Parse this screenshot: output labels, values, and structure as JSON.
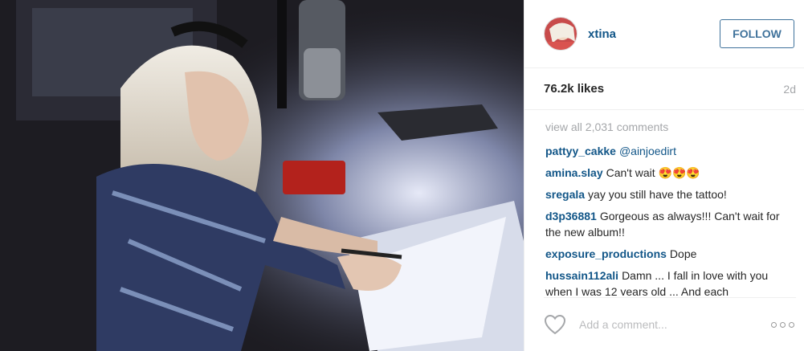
{
  "post": {
    "username": "xtina",
    "follow_label": "FOLLOW",
    "likes": "76.2k likes",
    "age": "2d",
    "view_all": "view all 2,031 comments",
    "comments": [
      {
        "user": "pattyy_cakke",
        "text": "",
        "mention": "@ainjoedirt"
      },
      {
        "user": "amina.slay",
        "text": "Can't wait 😍😍😍"
      },
      {
        "user": "sregala",
        "text": "yay you still have the tattoo!"
      },
      {
        "user": "d3p36881",
        "text": "Gorgeous as always!!! Can't wait for the new album!!"
      },
      {
        "user": "exposure_productions",
        "text": "Dope"
      },
      {
        "user": "hussain112ali",
        "text": "Damn ... I fall in love with you when I was 12 years old ... And each"
      }
    ],
    "add_comment_placeholder": "Add a comment...",
    "colors": {
      "username": "#125688",
      "follow_border": "#3f729b",
      "muted": "#a5a7aa"
    }
  },
  "icons": {
    "like": "heart-icon",
    "more": "more-options-icon"
  }
}
